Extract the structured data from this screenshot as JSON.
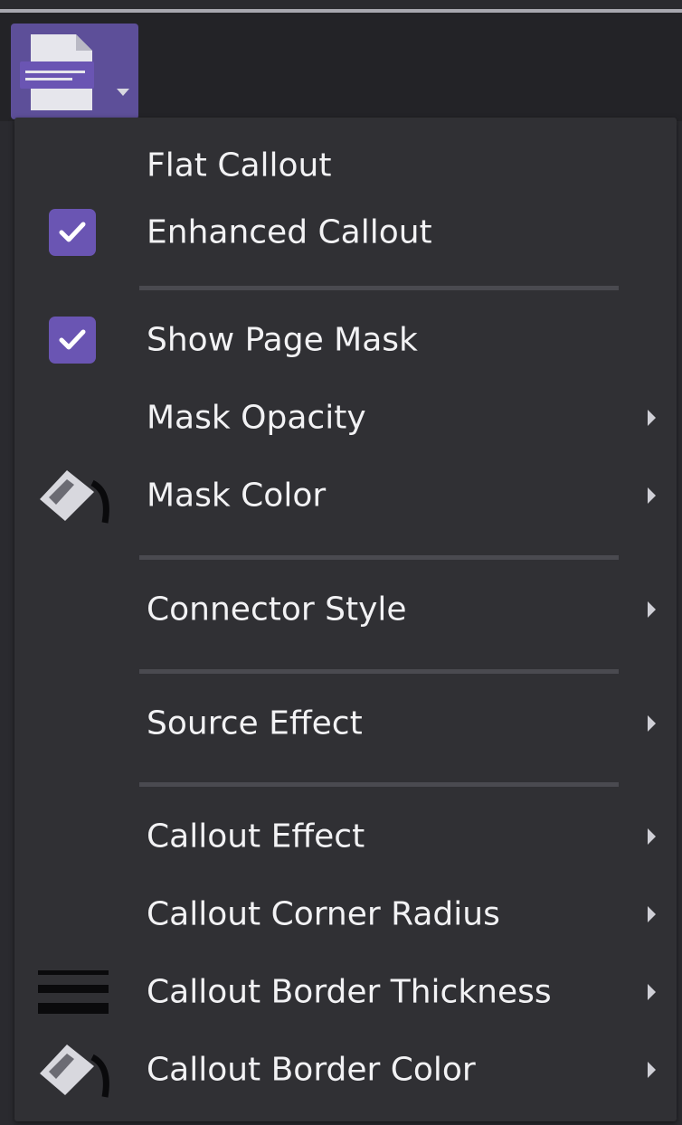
{
  "toolbar": {
    "button_icon": "callout-document-icon",
    "dropdown_icon": "chevron-down-icon"
  },
  "menu": {
    "items": [
      {
        "label": "Flat Callout",
        "checked": false
      },
      {
        "label": "Enhanced Callout",
        "checked": true
      },
      {
        "label": "Show Page Mask",
        "checked": true
      },
      {
        "label": "Mask Opacity",
        "submenu": true
      },
      {
        "label": "Mask Color",
        "icon": "paint-bucket-icon",
        "submenu": true
      },
      {
        "label": "Connector Style",
        "submenu": true
      },
      {
        "label": "Source Effect",
        "submenu": true
      },
      {
        "label": "Callout Effect",
        "submenu": true
      },
      {
        "label": "Callout Corner Radius",
        "submenu": true
      },
      {
        "label": "Callout Border Thickness",
        "icon": "line-thickness-icon",
        "submenu": true
      },
      {
        "label": "Callout Border Color",
        "icon": "paint-bucket-icon",
        "submenu": true
      }
    ]
  },
  "colors": {
    "accent": "#6a55b3",
    "menu_bg": "#303034",
    "text": "#f2f2f4",
    "separator": "#4a4a50"
  }
}
